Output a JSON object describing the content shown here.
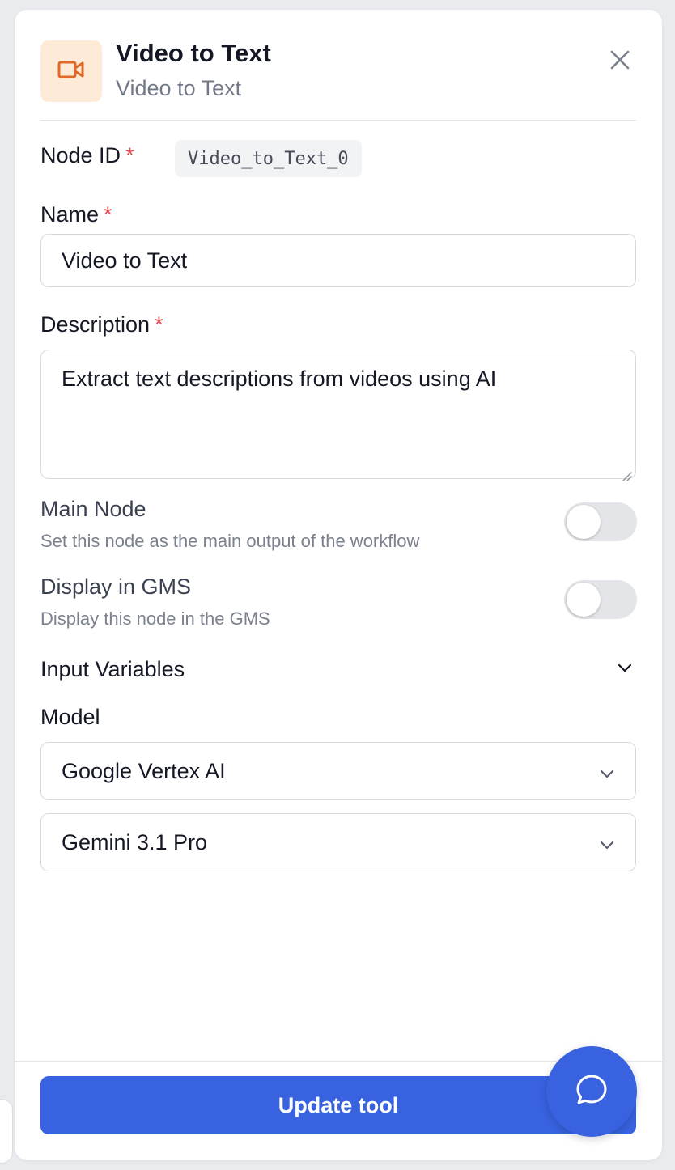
{
  "header": {
    "title": "Video to Text",
    "subtitle": "Video to Text",
    "icon": "video-camera-icon",
    "icon_color": "#e0692a",
    "icon_bg": "#fdebd8"
  },
  "node_id": {
    "label": "Node ID",
    "required_mark": "*",
    "value": "Video_to_Text_0"
  },
  "name": {
    "label": "Name",
    "required_mark": "*",
    "value": "Video to Text"
  },
  "description": {
    "label": "Description",
    "required_mark": "*",
    "value": "Extract text descriptions from videos using AI"
  },
  "main_node": {
    "title": "Main Node",
    "description": "Set this node as the main output of the workflow",
    "enabled": false
  },
  "display_in_gms": {
    "title": "Display in GMS",
    "description": "Display this node in the GMS",
    "enabled": false
  },
  "input_variables": {
    "label": "Input Variables",
    "expanded": false
  },
  "model": {
    "label": "Model",
    "provider": "Google Vertex AI",
    "model_name": "Gemini 3.1 Pro"
  },
  "footer": {
    "update_button": "Update tool"
  },
  "colors": {
    "primary": "#3862e0",
    "required": "#e5484d"
  }
}
